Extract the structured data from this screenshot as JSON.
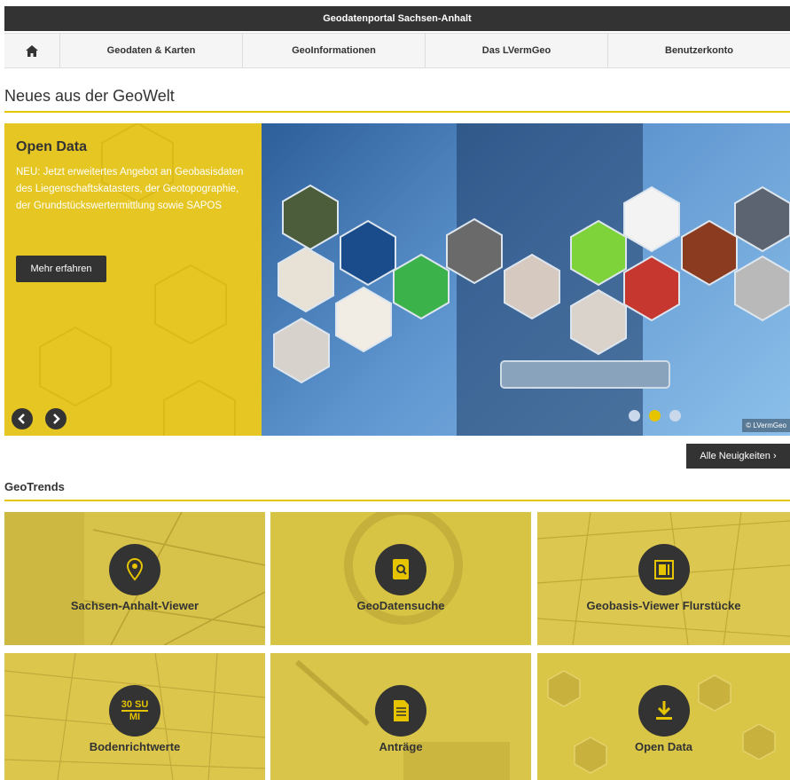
{
  "header": {
    "title": "Geodatenportal Sachsen-Anhalt"
  },
  "nav": {
    "home_icon": "home-icon",
    "items": [
      "Geodaten & Karten",
      "GeoInformationen",
      "Das LVermGeo",
      "Benutzerkonto"
    ]
  },
  "news": {
    "heading": "Neues aus der GeoWelt",
    "slide": {
      "title": "Open Data",
      "text": "NEU: Jetzt erweitertes Angebot an Geobasisdaten des Liegenschaftskatasters, der Geotopographie, der Grundstückswertermittlung sowie SAPOS",
      "button": "Mehr erfahren",
      "credit": "© LVermGeo"
    },
    "all_news": "Alle Neuigkeiten ›"
  },
  "geotrends": {
    "heading": "GeoTrends",
    "tiles": [
      {
        "label": "Sachsen-Anhalt-Viewer",
        "icon": "map-pin-icon"
      },
      {
        "label": "GeoDatensuche",
        "icon": "document-search-icon"
      },
      {
        "label": "Geobasis-Viewer Flurstücke",
        "icon": "parcel-icon"
      },
      {
        "label": "Bodenrichtwerte",
        "icon": "land-value-icon",
        "icon_text_top": "30 SU",
        "icon_text_bottom": "MI"
      },
      {
        "label": "Anträge",
        "icon": "form-document-icon"
      },
      {
        "label": "Open Data",
        "icon": "download-icon"
      }
    ]
  },
  "colors": {
    "accent": "#e6c400",
    "dark": "#333333"
  }
}
